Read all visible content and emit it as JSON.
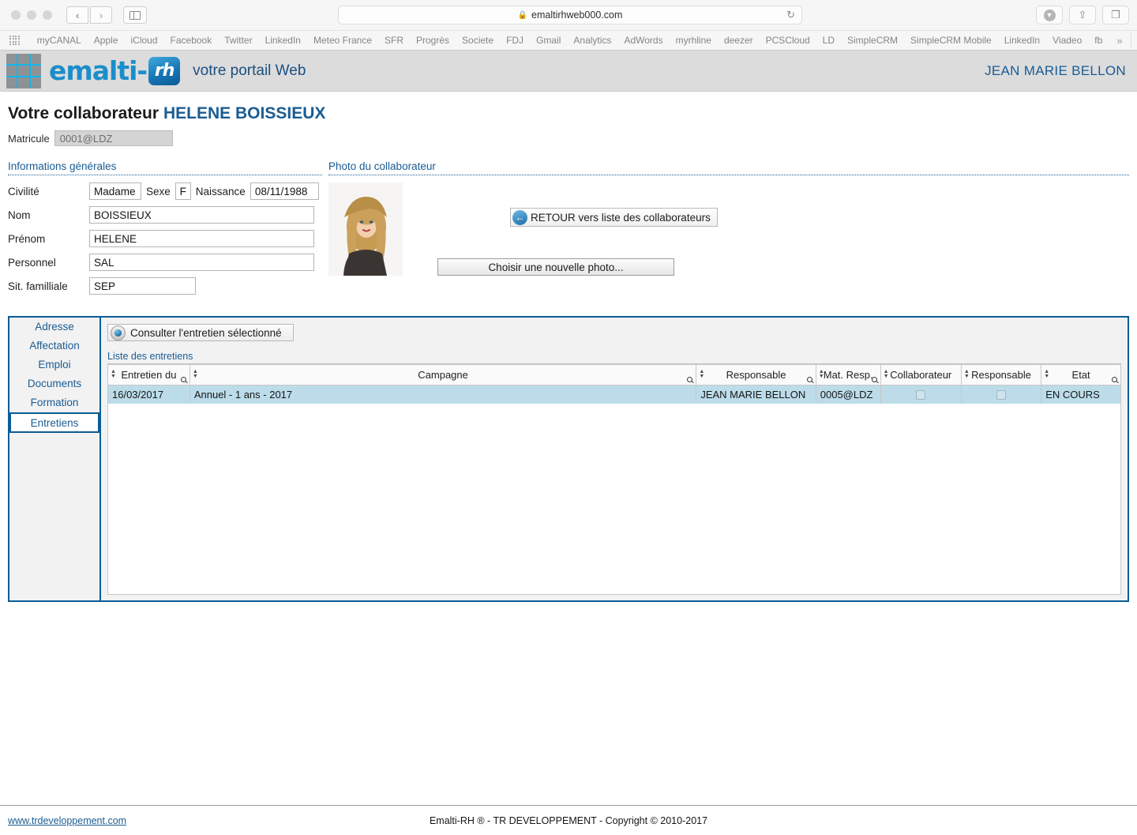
{
  "browser": {
    "url": "emaltirhweb000.com",
    "lock_icon": "lock-icon",
    "reload_icon": "reload-icon",
    "back_icon": "chevron-left-icon",
    "forward_icon": "chevron-right-icon",
    "sidebar_icon": "sidebar-toggle-icon",
    "download_icon": "download-icon",
    "share_icon": "share-icon",
    "tabs_icon": "show-tabs-icon",
    "bookmarks": [
      "myCANAL",
      "Apple",
      "iCloud",
      "Facebook",
      "Twitter",
      "LinkedIn",
      "Meteo France",
      "SFR",
      "Progrès",
      "Societe",
      "FDJ",
      "Gmail",
      "Analytics",
      "AdWords",
      "myrhline",
      "deezer",
      "PCSCloud",
      "LD",
      "SimpleCRM",
      "SimpleCRM Mobile",
      "LinkedIn",
      "Viadeo",
      "fb"
    ],
    "bookmarks_overflow": "»",
    "bookmarks_add": "+"
  },
  "app_header": {
    "logo_text": "emalti-",
    "logo_badge": "rh",
    "tagline": "votre portail Web",
    "user": "JEAN MARIE BELLON"
  },
  "page": {
    "title_prefix": "Votre collaborateur",
    "title_employee": "HELENE BOISSIEUX",
    "back_button": "RETOUR vers liste des collaborateurs",
    "matricule_label": "Matricule",
    "matricule_value": "0001@LDZ"
  },
  "general_info": {
    "section_title": "Informations générales",
    "fields": {
      "civilite_label": "Civilité",
      "civilite_value": "Madame",
      "sexe_label": "Sexe",
      "sexe_value": "F",
      "naissance_label": "Naissance",
      "naissance_value": "08/11/1988",
      "nom_label": "Nom",
      "nom_value": "BOISSIEUX",
      "prenom_label": "Prénom",
      "prenom_value": "HELENE",
      "personnel_label": "Personnel",
      "personnel_value": "SAL",
      "situation_label": "Sit. familliale",
      "situation_value": "SEP"
    }
  },
  "photo": {
    "section_title": "Photo du collaborateur",
    "choose_button": "Choisir une nouvelle photo..."
  },
  "tabs": {
    "items": [
      {
        "label": "Adresse",
        "selected": false
      },
      {
        "label": "Affectation",
        "selected": false
      },
      {
        "label": "Emploi",
        "selected": false
      },
      {
        "label": "Documents",
        "selected": false
      },
      {
        "label": "Formation",
        "selected": false
      },
      {
        "label": "Entretiens",
        "selected": true
      }
    ]
  },
  "panel": {
    "consult_button": "Consulter l'entretien sélectionné",
    "eye_icon": "eye-icon",
    "list_title": "Liste des entretiens",
    "columns": [
      "Entretien du",
      "Campagne",
      "Responsable",
      "Mat. Resp.",
      "Collaborateur",
      "Responsable",
      "Etat"
    ],
    "rows": [
      {
        "entretien_du": "16/03/2017",
        "campagne": "Annuel - 1 ans - 2017",
        "responsable": "JEAN MARIE BELLON",
        "mat_resp": "0005@LDZ",
        "collaborateur_checked": false,
        "responsable_checked": false,
        "etat": "EN COURS"
      }
    ]
  },
  "footer": {
    "link": "www.trdeveloppement.com",
    "copyright": "Emalti-RH ® - TR DEVELOPPEMENT - Copyright © 2010-2017"
  },
  "colors": {
    "brand_blue": "#1a5c93",
    "accent_cyan": "#12b6ea",
    "panel_border": "#0b5c96",
    "row_selected": "#bcdcea"
  }
}
